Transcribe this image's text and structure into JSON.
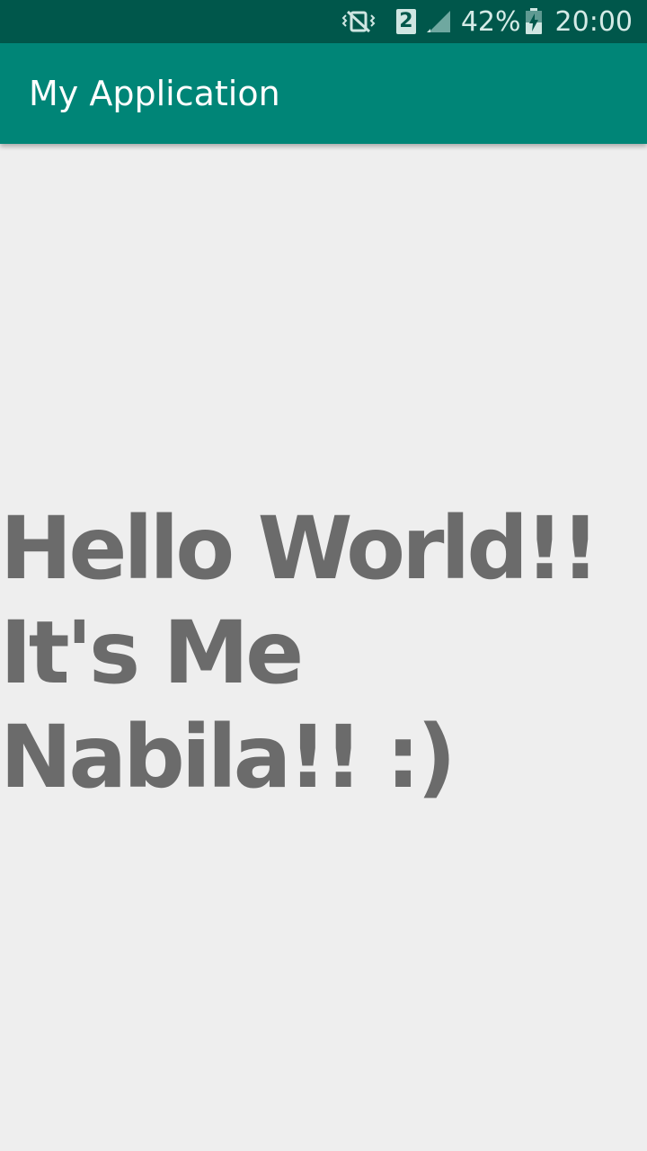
{
  "status_bar": {
    "battery_percent": "42%",
    "time": "20:00",
    "sim_slot": "2",
    "icons": [
      "vibrate-icon",
      "sim-icon",
      "signal-icon",
      "battery-charging-icon"
    ]
  },
  "app_bar": {
    "title": "My Application",
    "color": "#008577"
  },
  "main": {
    "message": "Hello World!!\nIt's Me\nNabila!! :)"
  }
}
